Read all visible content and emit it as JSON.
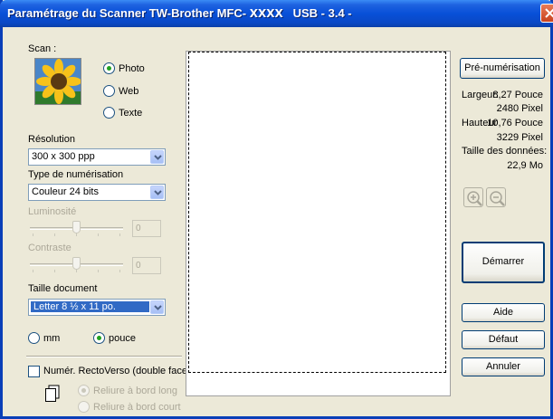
{
  "window": {
    "title_prefix": "Paramétrage du Scanner TW-Brother MFC-",
    "title_model": "XXXX",
    "title_suffix": "USB - 3.4 -"
  },
  "scan": {
    "label": "Scan :",
    "options": [
      {
        "label": "Photo",
        "selected": true
      },
      {
        "label": "Web",
        "selected": false
      },
      {
        "label": "Texte",
        "selected": false
      }
    ]
  },
  "resolution": {
    "label": "Résolution",
    "value": "300 x 300 ppp"
  },
  "scan_type": {
    "label": "Type de numérisation",
    "value": "Couleur 24 bits"
  },
  "brightness": {
    "label": "Luminosité",
    "value": "0"
  },
  "contrast": {
    "label": "Contraste",
    "value": "0"
  },
  "doc_size": {
    "label": "Taille document",
    "value": "Letter 8 ½ x 11 po."
  },
  "units": [
    {
      "label": "mm",
      "selected": false
    },
    {
      "label": "pouce",
      "selected": true
    }
  ],
  "duplex": {
    "label": "Numér. RectoVerso (double face)",
    "checked": false,
    "options": [
      {
        "label": "Reliure à bord long",
        "selected": true
      },
      {
        "label": "Reliure à bord court",
        "selected": false
      }
    ]
  },
  "info": {
    "prescan_label": "Pré-numérisation",
    "width_label": "Largeur:",
    "width_in": "8,27 Pouce",
    "width_px": "2480 Pixel",
    "height_label": "Hauteur",
    "height_in": "10,76 Pouce",
    "height_px": "3229 Pixel",
    "data_size_label": "Taille des données:",
    "data_size": "22,9 Mo"
  },
  "buttons": {
    "start": "Démarrer",
    "help": "Aide",
    "default": "Défaut",
    "cancel": "Annuler"
  },
  "icons": {
    "close": "close-icon",
    "photo_thumb": "sunflower-photo-icon",
    "zoom_in": "zoom-in-icon",
    "zoom_out": "zoom-out-icon",
    "duplex": "duplex-pages-icon"
  },
  "colors": {
    "titlebar": "#0850d8",
    "dialog_bg": "#ece9d8",
    "selection": "#316ac5"
  }
}
